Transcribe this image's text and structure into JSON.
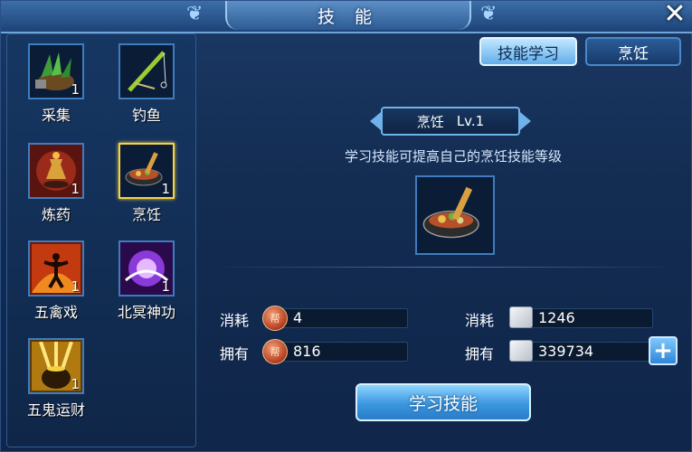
{
  "window": {
    "title": "技 能"
  },
  "skills": [
    {
      "name": "采集",
      "level": "1",
      "icon": "gather-herbs-icon"
    },
    {
      "name": "钓鱼",
      "level": "",
      "icon": "fishing-rod-icon"
    },
    {
      "name": "炼药",
      "level": "1",
      "icon": "alchemy-flask-icon"
    },
    {
      "name": "烹饪",
      "level": "1",
      "icon": "cooking-wok-icon"
    },
    {
      "name": "五禽戏",
      "level": "1",
      "icon": "fire-figure-icon"
    },
    {
      "name": "北冥神功",
      "level": "1",
      "icon": "purple-orb-icon"
    },
    {
      "name": "五鬼运财",
      "level": "1",
      "icon": "gold-pot-icon"
    }
  ],
  "tabs": {
    "learn": "技能学习",
    "cook": "烹饪"
  },
  "selected": {
    "name": "烹饪",
    "level": "Lv.1",
    "description": "学习技能可提高自己的烹饪技能等级"
  },
  "cost": {
    "label_consume": "消耗",
    "label_own": "拥有",
    "coin_consume": "4",
    "coin_own": "816",
    "scroll_consume": "1246",
    "scroll_own": "339734"
  },
  "learn_button": "学习技能",
  "colors": {
    "accent": "#3a97e0",
    "selected_border": "#f3d24a"
  }
}
